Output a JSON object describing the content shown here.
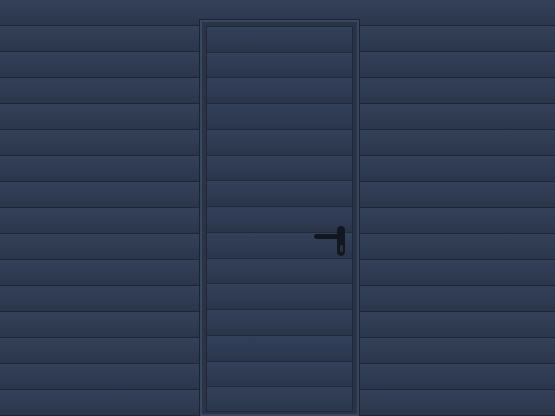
{
  "scene": {
    "subject": "",
    "colors": {
      "panel": "#2f3b51",
      "groove": "#1e2738",
      "frame": "#2a3446",
      "handle": "#111621"
    },
    "wall_panel_count": 16,
    "door_panel_count": 15,
    "icons": [
      "door-handle-icon"
    ]
  }
}
